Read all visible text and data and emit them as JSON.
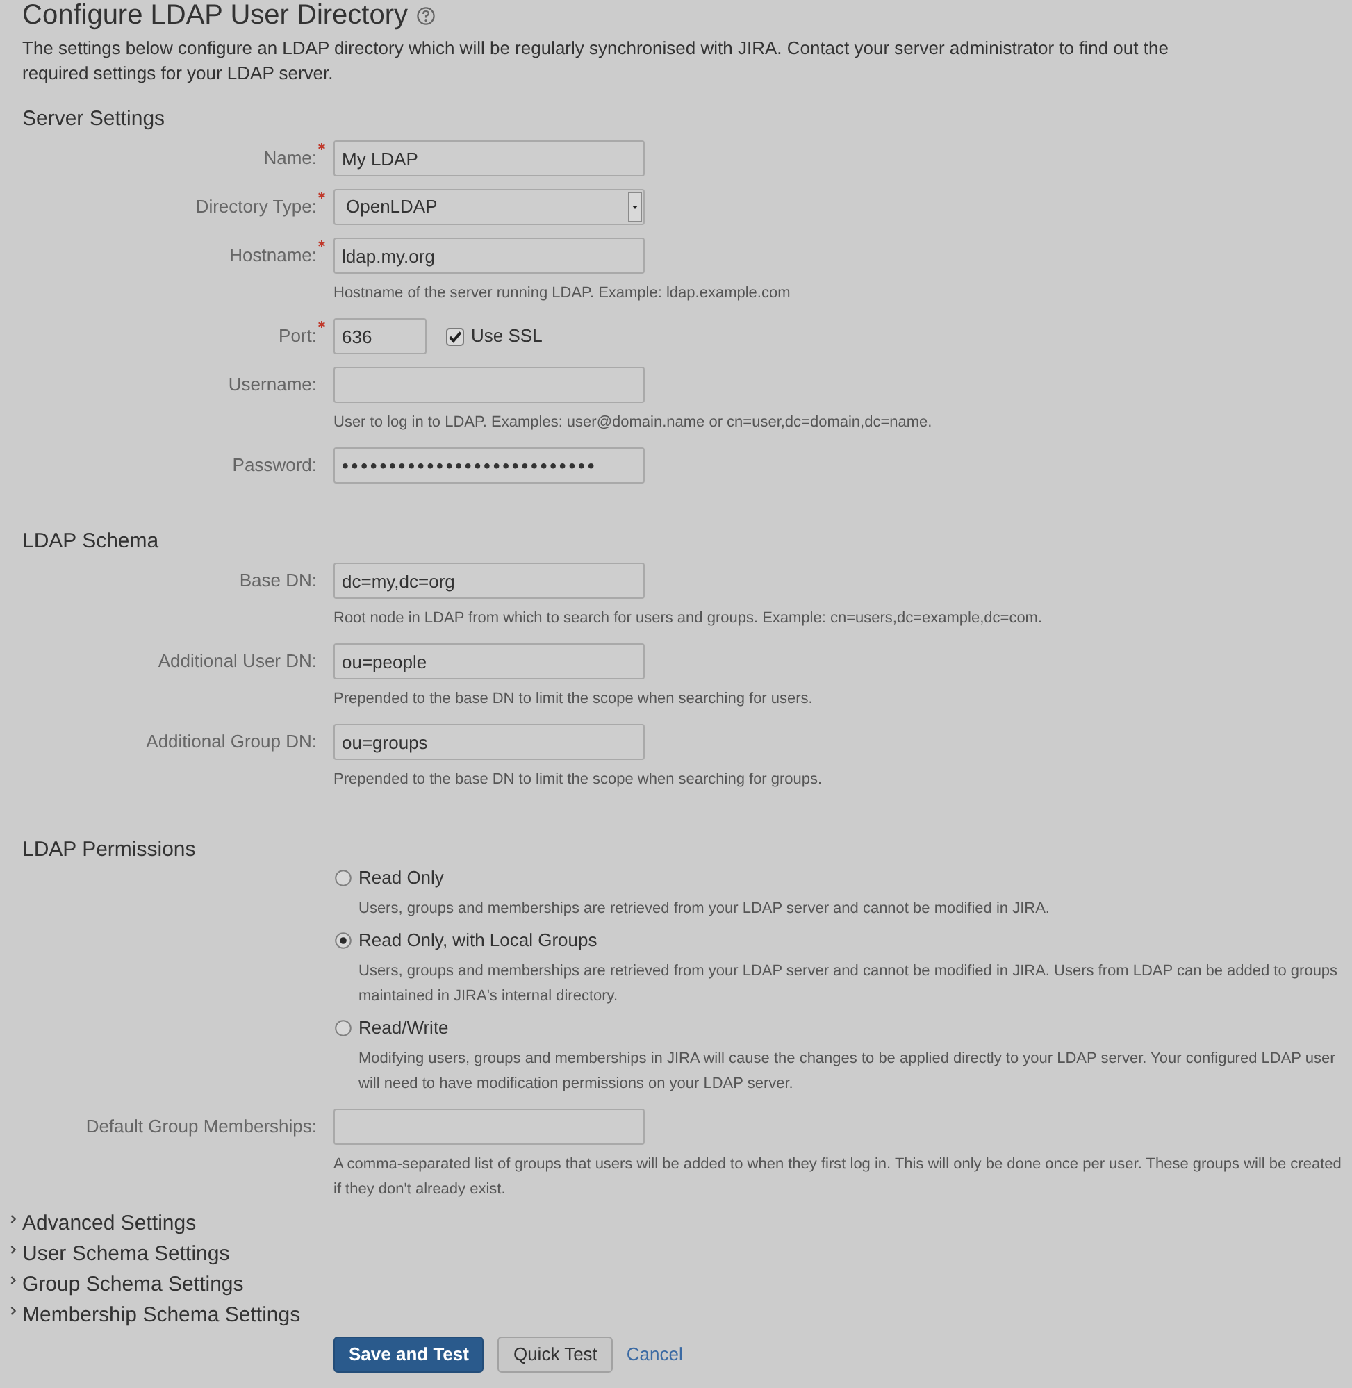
{
  "page": {
    "title": "Configure LDAP User Directory",
    "description": "The settings below configure an LDAP directory which will be regularly synchronised with JIRA. Contact your server administrator to find out the required settings for your LDAP server."
  },
  "sections": [
    {
      "heading": "Server Settings",
      "fields": [
        {
          "kind": "text",
          "label": "Name:",
          "required": true,
          "value": "My LDAP"
        },
        {
          "kind": "select",
          "label": "Directory Type:",
          "required": true,
          "value": "OpenLDAP"
        },
        {
          "kind": "text",
          "label": "Hostname:",
          "required": true,
          "value": "ldap.my.org",
          "hint": "Hostname of the server running LDAP. Example: ldap.example.com"
        },
        {
          "kind": "port",
          "label": "Port:",
          "required": true,
          "value": "636",
          "checkbox": {
            "label": "Use SSL",
            "checked": true
          }
        },
        {
          "kind": "text",
          "label": "Username:",
          "required": false,
          "hint": "User to log in to LDAP. Examples: user@domain.name or cn=user,dc=domain,dc=name."
        },
        {
          "kind": "password",
          "label": "Password:",
          "required": false,
          "value": "•••••••••••••••••••••••••••"
        }
      ]
    },
    {
      "heading": "LDAP Schema",
      "fields": [
        {
          "kind": "text",
          "label": "Base DN:",
          "required": false,
          "value": "dc=my,dc=org",
          "hint": "Root node in LDAP from which to search for users and groups. Example: cn=users,dc=example,dc=com."
        },
        {
          "kind": "text",
          "label": "Additional User DN:",
          "required": false,
          "value": "ou=people",
          "hint": "Prepended to the base DN to limit the scope when searching for users."
        },
        {
          "kind": "text",
          "label": "Additional Group DN:",
          "required": false,
          "value": "ou=groups",
          "hint": "Prepended to the base DN to limit the scope when searching for groups."
        }
      ]
    },
    {
      "heading": "LDAP Permissions",
      "options": [
        {
          "label": "Read Only",
          "description": "Users, groups and memberships are retrieved from your LDAP server and cannot be modified in JIRA.",
          "selected": false
        },
        {
          "label": "Read Only, with Local Groups",
          "description": "Users, groups and memberships are retrieved from your LDAP server and cannot be modified in JIRA. Users from LDAP can be added to groups maintained in JIRA's internal directory.",
          "selected": true
        },
        {
          "label": "Read/Write",
          "description": "Modifying users, groups and memberships in JIRA will cause the changes to be applied directly to your LDAP server. Your configured LDAP user will need to have modification permissions on your LDAP server.",
          "selected": false
        }
      ],
      "fields": [
        {
          "kind": "text",
          "label": "Default Group Memberships:",
          "required": false,
          "hint": "A comma-separated list of groups that users will be added to when they first log in. This will only be done once per user. These groups will be created if they don't already exist."
        }
      ]
    }
  ],
  "collapsibles": [
    {
      "label": "Advanced Settings",
      "expanded": false
    },
    {
      "label": "User Schema Settings",
      "expanded": false
    },
    {
      "label": "Group Schema Settings",
      "expanded": false
    },
    {
      "label": "Membership Schema Settings",
      "expanded": false
    }
  ],
  "buttons": [
    {
      "kind": "primary",
      "label": "Save and Test"
    },
    {
      "kind": "secondary",
      "label": "Quick Test"
    },
    {
      "kind": "link",
      "label": "Cancel"
    }
  ]
}
